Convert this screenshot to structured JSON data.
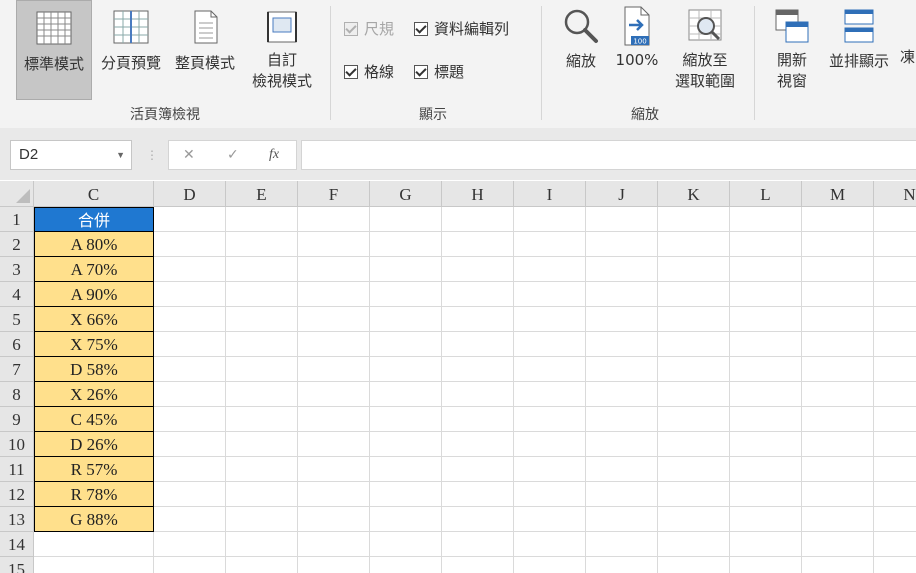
{
  "ribbon": {
    "view_buttons": [
      {
        "label": "標準模式",
        "name": "normal-view-button",
        "active": true
      },
      {
        "label": "分頁預覽",
        "name": "page-break-preview-button"
      },
      {
        "label": "整頁模式",
        "name": "page-layout-button"
      },
      {
        "label1": "自訂",
        "label2": "檢視模式",
        "name": "custom-views-button"
      }
    ],
    "group_workbook_views": "活頁簿檢視",
    "show": {
      "ruler": "尺規",
      "formula_bar": "資料編輯列",
      "gridlines": "格線",
      "headings": "標題",
      "group_label": "顯示"
    },
    "zoom": {
      "zoom_label": "縮放",
      "hundred_label": "100%",
      "to_selection_l1": "縮放至",
      "to_selection_l2": "選取範圍",
      "group_label": "縮放",
      "hundred_badge": "100"
    },
    "window": {
      "new_window_l1": "開新",
      "new_window_l2": "視窗",
      "arrange_all": "並排顯示",
      "freeze_partial": "凍"
    }
  },
  "formula_bar": {
    "name_box": "D2",
    "cancel_glyph": "✕",
    "enter_glyph": "✓",
    "fx_glyph": "fx",
    "formula_value": ""
  },
  "sheet": {
    "columns": [
      "C",
      "D",
      "E",
      "F",
      "G",
      "H",
      "I",
      "J",
      "K",
      "L",
      "M",
      "N"
    ],
    "rows": [
      "1",
      "2",
      "3",
      "4",
      "5",
      "6",
      "7",
      "8",
      "9",
      "10",
      "11",
      "12",
      "13",
      "14",
      "15"
    ],
    "header_cell": "合併",
    "data_cells": [
      "A 80%",
      "A 70%",
      "A 90%",
      "X 66%",
      "X 75%",
      "D 58%",
      "X 26%",
      "C 45%",
      "D 26%",
      "R 57%",
      "R 78%",
      "G 88%"
    ],
    "colors": {
      "header_fill": "#1f78d1",
      "data_fill": "#ffe08c"
    }
  }
}
